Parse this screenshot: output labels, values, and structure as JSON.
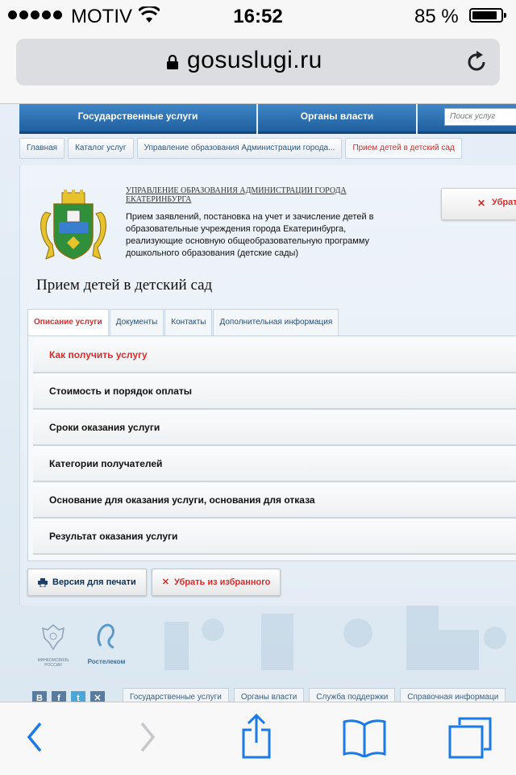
{
  "status_bar": {
    "carrier": "MOTIV",
    "time": "16:52",
    "battery": "85 %",
    "signal_icon": "signal-dots-icon",
    "wifi_icon": "wifi-icon",
    "battery_icon": "battery-icon"
  },
  "browser": {
    "url": "gosuslugi.ru",
    "lock_icon": "lock-icon",
    "reload_icon": "reload-icon"
  },
  "topnav": {
    "items": [
      "Государственные услуги",
      "Органы власти"
    ],
    "search_placeholder": "Поиск услуг"
  },
  "breadcrumbs": [
    "Главная",
    "Каталог услуг",
    "Управление образования Администрации города...",
    "Прием детей в детский сад"
  ],
  "org": {
    "name": "Управление образования Администрации города Екатеринбурга",
    "description": "Прием заявлений, постановка на учет и зачисление детей в образовательные учреждения города Екатеринбурга, реализующие основную общеобразовательную программу дошкольного образования (детские сады)",
    "favorite_button": "Убрат"
  },
  "page_title": "Прием детей в детский сад",
  "tabs": [
    "Описание услуги",
    "Документы",
    "Контакты",
    "Дополнительная информация"
  ],
  "accordion": [
    "Как получить услугу",
    "Стоимость и порядок оплаты",
    "Сроки оказания услуги",
    "Категории получателей",
    "Основание для оказания услуги, основания для отказа",
    "Результат оказания услуги"
  ],
  "actions": {
    "print": "Версия для печати",
    "unfavorite": "Убрать из избранного"
  },
  "footer": {
    "ministry_caption": "МИНКОМСВЯЗЬ РОССИИ",
    "rostelecom_caption": "Ростелеком",
    "social": [
      "В",
      "f",
      "t",
      "✕"
    ],
    "links": [
      "Государственные услуги",
      "Органы власти",
      "Служба поддержки",
      "Справочная информаци"
    ]
  },
  "colors": {
    "nav_blue": "#2a6fb0",
    "accent_red": "#d42f2f",
    "ios_blue": "#1a7ae8"
  }
}
